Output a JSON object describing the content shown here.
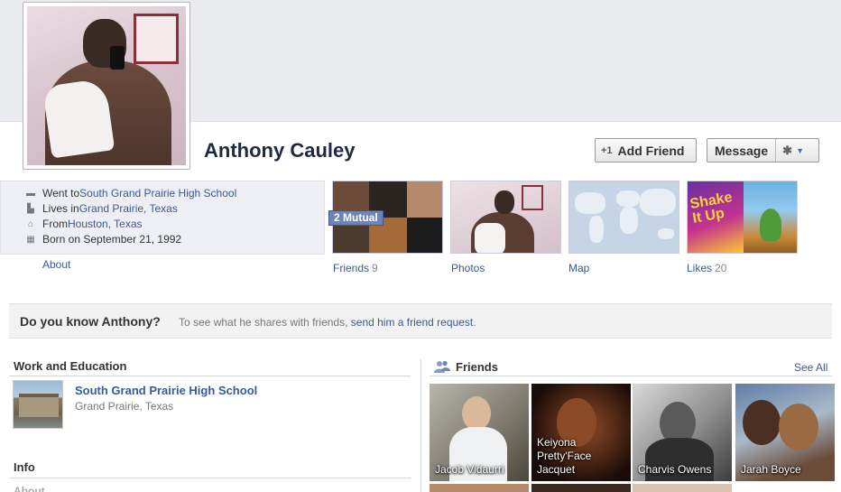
{
  "profile": {
    "name": "Anthony Cauley",
    "add_friend_label": "Add Friend",
    "message_label": "Message"
  },
  "info": {
    "school_prefix": "Went to ",
    "school": "South Grand Prairie High School",
    "lives_prefix": "Lives in ",
    "lives": "Grand Prairie, Texas",
    "from_prefix": "From ",
    "from": "Houston, Texas",
    "born": "Born on September 21, 1992",
    "about_link": "About"
  },
  "tiles": {
    "mutual_badge": "2 Mutual",
    "friends_label": "Friends",
    "friends_count": "9",
    "photos_label": "Photos",
    "map_label": "Map",
    "likes_label": "Likes",
    "likes_count": "20"
  },
  "know_bar": {
    "title": "Do you know Anthony?",
    "sub_prefix": "To see what he shares with friends, ",
    "sub_link": "send him a friend request",
    "sub_suffix": "."
  },
  "work_education": {
    "title": "Work and Education",
    "school_name": "South Grand Prairie High School",
    "school_location": "Grand Prairie, Texas"
  },
  "info_section": {
    "title": "Info",
    "about_peek": "About"
  },
  "friends_section": {
    "title": "Friends",
    "see_all": "See All",
    "friends": [
      {
        "name": "Jacob Vidaurri"
      },
      {
        "name": "Keiyona\nPretty'Face\nJacquet"
      },
      {
        "name": "Charvis Owens"
      },
      {
        "name": "Jarah Boyce"
      }
    ]
  },
  "colors": {
    "link": "#3b5998",
    "cover_bg": "#e9ebee",
    "info_bg": "#edeff4",
    "mutual_badge_bg": "#6d84b4"
  },
  "icons": [
    "graduation-icon",
    "home-building-icon",
    "house-icon",
    "calendar-icon",
    "add-friend-icon",
    "gear-icon",
    "chevron-down-icon",
    "friends-icon"
  ]
}
